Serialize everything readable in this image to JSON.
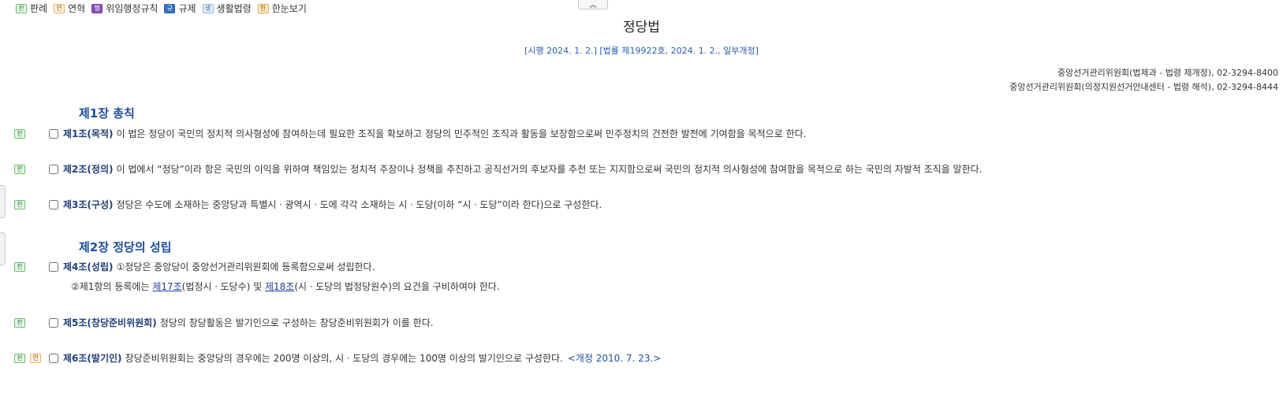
{
  "legend": [
    {
      "badge": "판",
      "label": "판례",
      "cls": "b-pan",
      "icon": "precedent-icon"
    },
    {
      "badge": "연",
      "label": "연혁",
      "cls": "b-yeon",
      "icon": "history-icon"
    },
    {
      "badge": "행",
      "label": "위임행정규칙",
      "cls": "b-haeng",
      "icon": "admin-rule-icon"
    },
    {
      "badge": "규",
      "label": "규제",
      "cls": "b-gyu",
      "icon": "regulation-icon"
    },
    {
      "badge": "생",
      "label": "생활법령",
      "cls": "b-saeng",
      "icon": "life-law-icon"
    },
    {
      "badge": "한",
      "label": "한눈보기",
      "cls": "b-hanmun",
      "icon": "overview-icon"
    }
  ],
  "collapse_glyph": "︽",
  "law": {
    "title": "정당법",
    "subtitle": "[시행 2024. 1. 2.] [법률 제19922호, 2024. 1. 2., 일부개정]",
    "contact1": "중앙선거관리위원회(법제과 - 법령 제개정), 02-3294-8400",
    "contact2": "중앙선거관리위원회(의정지원선거안내센터 - 법령 해석), 02-3294-8444"
  },
  "chapters": {
    "ch1": "제1장 총칙",
    "ch2": "제2장 정당의 성립"
  },
  "articles": {
    "a1": {
      "title": "제1조(목적)",
      "text": "이 법은 정당이 국민의 정치적 의사형성에 참여하는데 필요한 조직을 확보하고 정당의 민주적인 조직과 활동을 보장함으로써 민주정치의 건전한 발전에 기여함을 목적으로 한다."
    },
    "a2": {
      "title": "제2조(정의)",
      "text": "이 법에서 “정당”이라 함은 국민의 이익을 위하여 책임있는 정치적 주장이나 정책을 추진하고 공직선거의 후보자를 추천 또는 지지함으로써 국민의 정치적 의사형성에 참여함을 목적으로 하는 국민의 자발적 조직을 말한다."
    },
    "a3": {
      "title": "제3조(구성)",
      "text": "정당은 수도에 소재하는 중앙당과 특별시ㆍ광역시ㆍ도에 각각 소재하는 시ㆍ도당(이하 “시ㆍ도당”이라 한다)으로 구성한다."
    },
    "a4": {
      "title": "제4조(성립)",
      "text": "①정당은 중앙당이 중앙선거관리위원회에 등록함으로써 성립한다.",
      "p2_a": "②제1항의 등록에는 ",
      "link1": "제17조",
      "p2_b": "(법정시ㆍ도당수) 및 ",
      "link2": "제18조",
      "p2_c": "(시ㆍ도당의 법정당원수)의 요건을 구비하여야 한다."
    },
    "a5": {
      "title": "제5조(창당준비위원회)",
      "text": "정당의 창당활동은 발기인으로 구성하는 창당준비위원회가 이를 한다."
    },
    "a6": {
      "title": "제6조(발기인)",
      "text": "창당준비위원회는 중앙당의 경우에는 200명 이상의, 시ㆍ도당의 경우에는 100명 이상의 발기인으로 구성한다.",
      "revision": "<개정 2010. 7. 23.>"
    }
  },
  "badges": {
    "pan": "판",
    "yeon": "연"
  }
}
